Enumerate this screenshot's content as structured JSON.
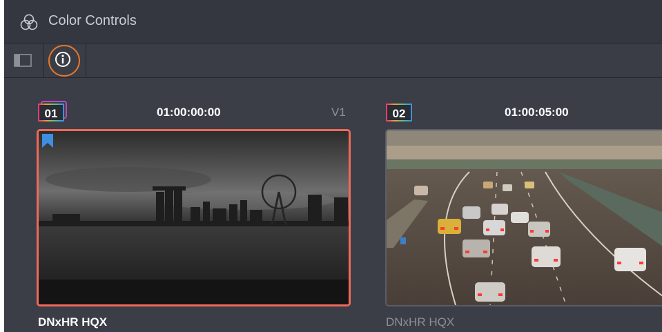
{
  "panel": {
    "title": "Color Controls",
    "title_icon": "color-circles-icon"
  },
  "toolbar": {
    "sidebar_icon": "sidebar-toggle-icon",
    "info_icon": "info-icon",
    "info_highlight_color": "#e2782d"
  },
  "clips": [
    {
      "number": "01",
      "timecode": "01:00:00:00",
      "track": "V1",
      "codec": "DNxHR HQX",
      "selected": true,
      "flagged": true,
      "selection_color": "#f06a5a",
      "flag_color": "#3f8fe0"
    },
    {
      "number": "02",
      "timecode": "01:00:05:00",
      "track": "",
      "codec": "DNxHR HQX",
      "selected": false,
      "flagged": false
    }
  ]
}
